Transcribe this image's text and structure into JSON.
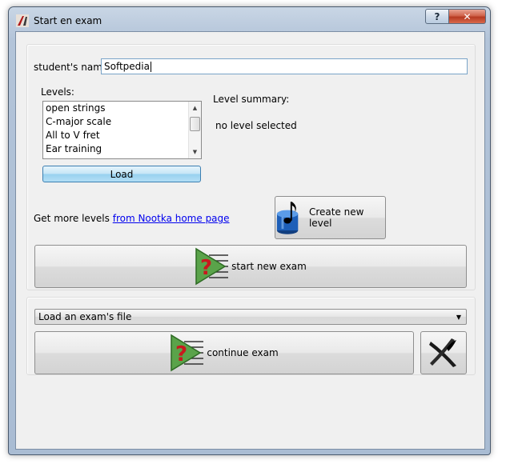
{
  "window": {
    "title": "Start en exam",
    "help_label": "?",
    "close_label": "✕"
  },
  "student": {
    "label": "student's name:",
    "value": "Softpedia"
  },
  "levels": {
    "label": "Levels:",
    "items": [
      "open strings",
      "C-major scale",
      "All to V fret",
      "Ear training"
    ],
    "load_label": "Load"
  },
  "summary": {
    "label": "Level summary:",
    "text": "no level selected"
  },
  "more_levels": {
    "text": "Get more levels",
    "link": "from Nootka home page"
  },
  "buttons": {
    "create_level": "Create new level",
    "start_exam": "start new exam",
    "continue_exam": "continue exam"
  },
  "exam_file": {
    "selected": "Load an exam's file"
  },
  "colors": {
    "accent": "#98d1ef",
    "exam_icon_green": "#5aa34a",
    "exam_icon_red": "#c8191e",
    "db_blue": "#1d5fb8"
  }
}
